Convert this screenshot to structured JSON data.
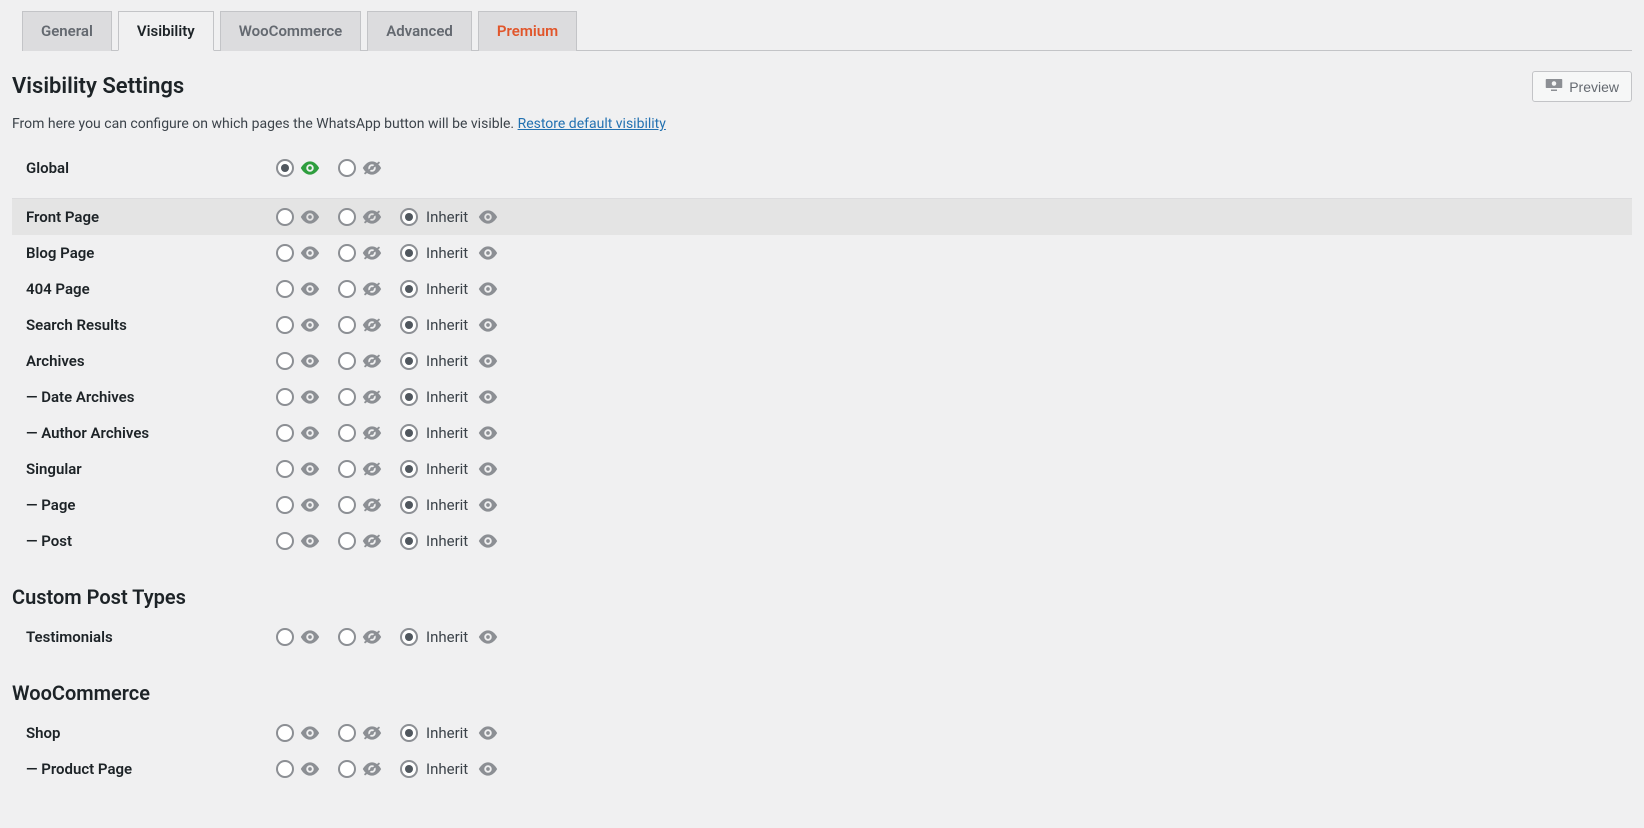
{
  "tabs": {
    "general": "General",
    "visibility": "Visibility",
    "woocommerce": "WooCommerce",
    "advanced": "Advanced",
    "premium": "Premium"
  },
  "heading": "Visibility Settings",
  "preview_label": "Preview",
  "description": "From here you can configure on which pages the WhatsApp button will be visible. ",
  "restore_link": "Restore default visibility",
  "inherit_label": "Inherit",
  "rows": {
    "global": "Global",
    "front_page": "Front Page",
    "blog_page": "Blog Page",
    "404_page": "404 Page",
    "search_results": "Search Results",
    "archives": "Archives",
    "date_archives": "— Date Archives",
    "author_archives": "— Author Archives",
    "singular": "Singular",
    "page": "— Page",
    "post": "— Post",
    "testimonials": "Testimonials",
    "shop": "Shop",
    "product_page": "— Product Page"
  },
  "sections": {
    "custom_post_types": "Custom Post Types",
    "woocommerce": "WooCommerce"
  }
}
